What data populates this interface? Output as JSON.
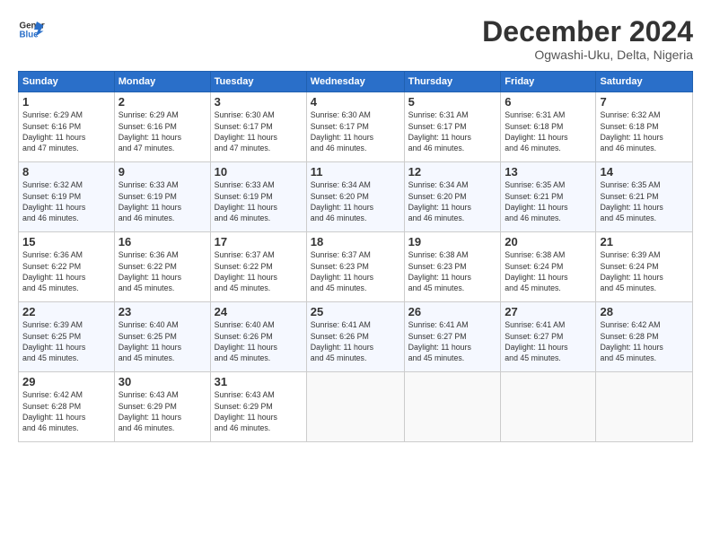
{
  "logo": {
    "line1": "General",
    "line2": "Blue"
  },
  "title": "December 2024",
  "subtitle": "Ogwashi-Uku, Delta, Nigeria",
  "days_of_week": [
    "Sunday",
    "Monday",
    "Tuesday",
    "Wednesday",
    "Thursday",
    "Friday",
    "Saturday"
  ],
  "weeks": [
    [
      {
        "day": "1",
        "info": "Sunrise: 6:29 AM\nSunset: 6:16 PM\nDaylight: 11 hours\nand 47 minutes."
      },
      {
        "day": "2",
        "info": "Sunrise: 6:29 AM\nSunset: 6:16 PM\nDaylight: 11 hours\nand 47 minutes."
      },
      {
        "day": "3",
        "info": "Sunrise: 6:30 AM\nSunset: 6:17 PM\nDaylight: 11 hours\nand 47 minutes."
      },
      {
        "day": "4",
        "info": "Sunrise: 6:30 AM\nSunset: 6:17 PM\nDaylight: 11 hours\nand 46 minutes."
      },
      {
        "day": "5",
        "info": "Sunrise: 6:31 AM\nSunset: 6:17 PM\nDaylight: 11 hours\nand 46 minutes."
      },
      {
        "day": "6",
        "info": "Sunrise: 6:31 AM\nSunset: 6:18 PM\nDaylight: 11 hours\nand 46 minutes."
      },
      {
        "day": "7",
        "info": "Sunrise: 6:32 AM\nSunset: 6:18 PM\nDaylight: 11 hours\nand 46 minutes."
      }
    ],
    [
      {
        "day": "8",
        "info": "Sunrise: 6:32 AM\nSunset: 6:19 PM\nDaylight: 11 hours\nand 46 minutes."
      },
      {
        "day": "9",
        "info": "Sunrise: 6:33 AM\nSunset: 6:19 PM\nDaylight: 11 hours\nand 46 minutes."
      },
      {
        "day": "10",
        "info": "Sunrise: 6:33 AM\nSunset: 6:19 PM\nDaylight: 11 hours\nand 46 minutes."
      },
      {
        "day": "11",
        "info": "Sunrise: 6:34 AM\nSunset: 6:20 PM\nDaylight: 11 hours\nand 46 minutes."
      },
      {
        "day": "12",
        "info": "Sunrise: 6:34 AM\nSunset: 6:20 PM\nDaylight: 11 hours\nand 46 minutes."
      },
      {
        "day": "13",
        "info": "Sunrise: 6:35 AM\nSunset: 6:21 PM\nDaylight: 11 hours\nand 46 minutes."
      },
      {
        "day": "14",
        "info": "Sunrise: 6:35 AM\nSunset: 6:21 PM\nDaylight: 11 hours\nand 45 minutes."
      }
    ],
    [
      {
        "day": "15",
        "info": "Sunrise: 6:36 AM\nSunset: 6:22 PM\nDaylight: 11 hours\nand 45 minutes."
      },
      {
        "day": "16",
        "info": "Sunrise: 6:36 AM\nSunset: 6:22 PM\nDaylight: 11 hours\nand 45 minutes."
      },
      {
        "day": "17",
        "info": "Sunrise: 6:37 AM\nSunset: 6:22 PM\nDaylight: 11 hours\nand 45 minutes."
      },
      {
        "day": "18",
        "info": "Sunrise: 6:37 AM\nSunset: 6:23 PM\nDaylight: 11 hours\nand 45 minutes."
      },
      {
        "day": "19",
        "info": "Sunrise: 6:38 AM\nSunset: 6:23 PM\nDaylight: 11 hours\nand 45 minutes."
      },
      {
        "day": "20",
        "info": "Sunrise: 6:38 AM\nSunset: 6:24 PM\nDaylight: 11 hours\nand 45 minutes."
      },
      {
        "day": "21",
        "info": "Sunrise: 6:39 AM\nSunset: 6:24 PM\nDaylight: 11 hours\nand 45 minutes."
      }
    ],
    [
      {
        "day": "22",
        "info": "Sunrise: 6:39 AM\nSunset: 6:25 PM\nDaylight: 11 hours\nand 45 minutes."
      },
      {
        "day": "23",
        "info": "Sunrise: 6:40 AM\nSunset: 6:25 PM\nDaylight: 11 hours\nand 45 minutes."
      },
      {
        "day": "24",
        "info": "Sunrise: 6:40 AM\nSunset: 6:26 PM\nDaylight: 11 hours\nand 45 minutes."
      },
      {
        "day": "25",
        "info": "Sunrise: 6:41 AM\nSunset: 6:26 PM\nDaylight: 11 hours\nand 45 minutes."
      },
      {
        "day": "26",
        "info": "Sunrise: 6:41 AM\nSunset: 6:27 PM\nDaylight: 11 hours\nand 45 minutes."
      },
      {
        "day": "27",
        "info": "Sunrise: 6:41 AM\nSunset: 6:27 PM\nDaylight: 11 hours\nand 45 minutes."
      },
      {
        "day": "28",
        "info": "Sunrise: 6:42 AM\nSunset: 6:28 PM\nDaylight: 11 hours\nand 45 minutes."
      }
    ],
    [
      {
        "day": "29",
        "info": "Sunrise: 6:42 AM\nSunset: 6:28 PM\nDaylight: 11 hours\nand 46 minutes."
      },
      {
        "day": "30",
        "info": "Sunrise: 6:43 AM\nSunset: 6:29 PM\nDaylight: 11 hours\nand 46 minutes."
      },
      {
        "day": "31",
        "info": "Sunrise: 6:43 AM\nSunset: 6:29 PM\nDaylight: 11 hours\nand 46 minutes."
      },
      {
        "day": "",
        "info": ""
      },
      {
        "day": "",
        "info": ""
      },
      {
        "day": "",
        "info": ""
      },
      {
        "day": "",
        "info": ""
      }
    ]
  ]
}
